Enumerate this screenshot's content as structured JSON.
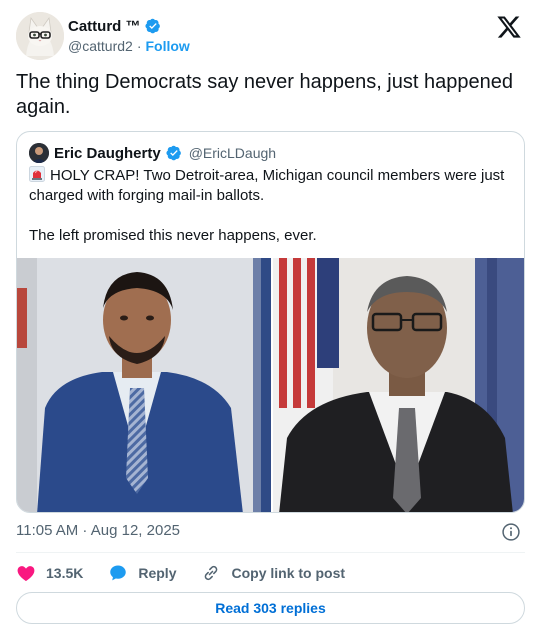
{
  "author": {
    "display_name": "Catturd ™",
    "handle": "@catturd2",
    "separator": "·",
    "follow_label": "Follow"
  },
  "tweet": {
    "text": "The thing Democrats say never happens, just happened again.",
    "timestamp": "11:05 AM · Aug 12, 2025"
  },
  "quoted_tweet": {
    "display_name": "Eric Daugherty",
    "handle": "@EricLDaugh",
    "line1": "HOLY CRAP! Two Detroit-area, Michigan council members were just charged with forging mail-in ballots.",
    "line2": "The left promised this never happens, ever."
  },
  "actions": {
    "like_count": "13.5K",
    "reply_label": "Reply",
    "copy_link_label": "Copy link to post",
    "read_replies_label": "Read 303 replies"
  },
  "icons": {
    "verified": "verified-badge-icon",
    "x_logo": "x-logo-icon",
    "siren": "rotating-light-emoji-icon",
    "info": "info-icon",
    "heart": "heart-icon",
    "reply": "speech-bubble-icon",
    "link": "link-icon"
  },
  "colors": {
    "verified_blue": "#1d9bf0",
    "heart_pink": "#f91880",
    "link_blue": "#006fd6",
    "muted_text": "#536471",
    "border": "#cfd9de"
  }
}
